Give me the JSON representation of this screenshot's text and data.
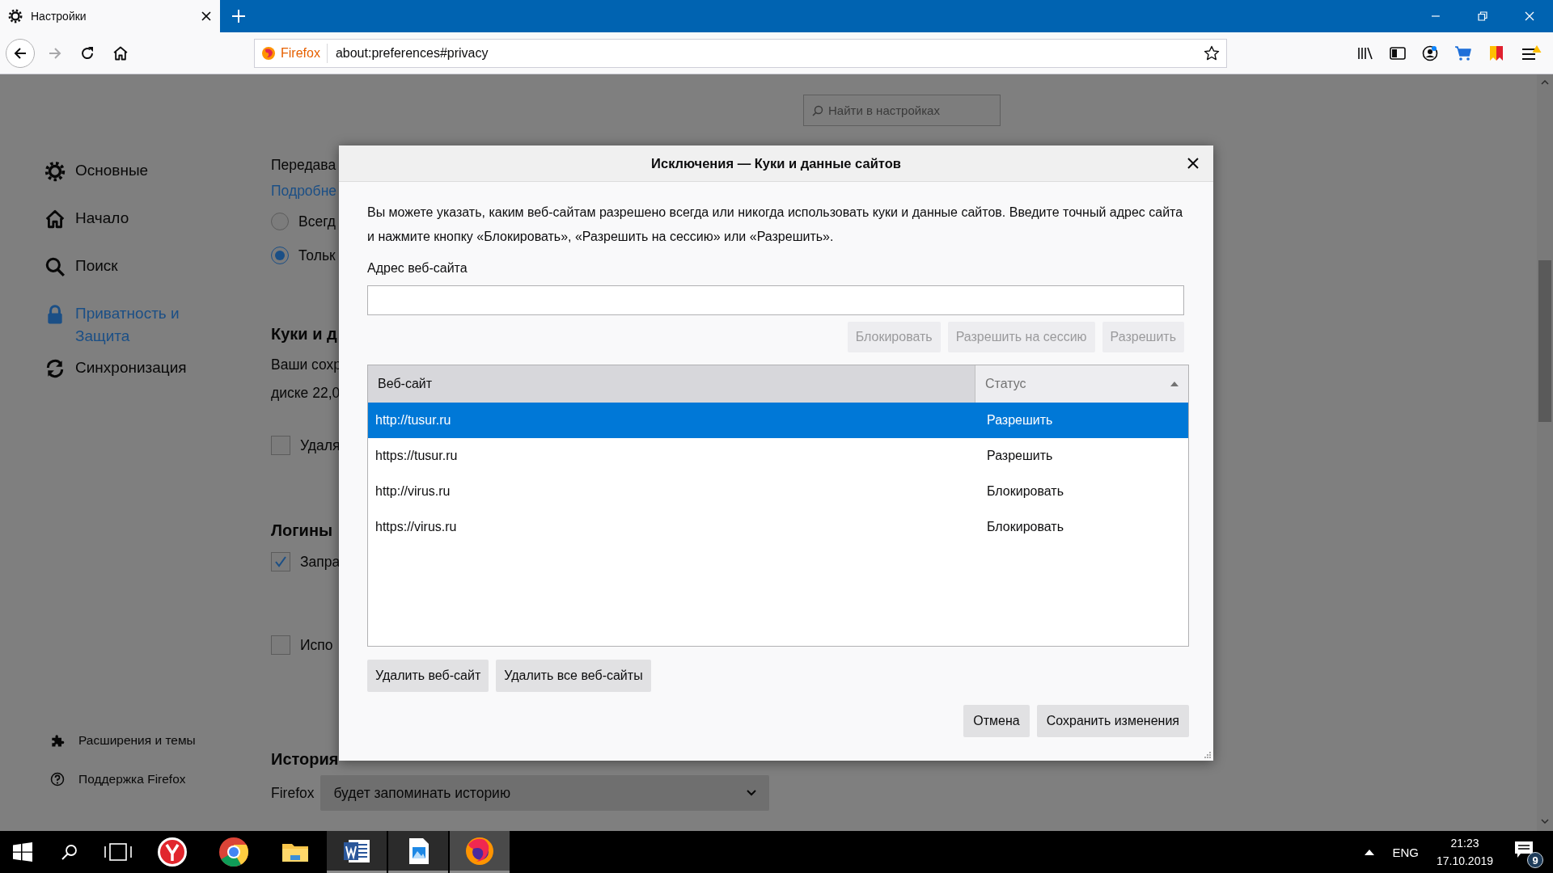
{
  "browser": {
    "tab": {
      "title": "Настройки"
    },
    "identity": "Firefox",
    "url": "about:preferences#privacy",
    "forward": {
      "disabled": true
    }
  },
  "search": {
    "placeholder": "Найти в настройках"
  },
  "sidebar": {
    "items": [
      {
        "label": "Основные",
        "selected": false
      },
      {
        "label": "Начало",
        "selected": false
      },
      {
        "label": "Поиск",
        "selected": false
      },
      {
        "label": "Приватность и Защита",
        "selected": true
      },
      {
        "label": "Синхронизация",
        "selected": false
      }
    ],
    "footer": [
      {
        "label": "Расширения и темы"
      },
      {
        "label": "Поддержка Firefox"
      }
    ]
  },
  "page": {
    "items": [
      {
        "kind": "text",
        "text": "Передава"
      },
      {
        "kind": "link",
        "text": "Подробне"
      },
      {
        "kind": "radio",
        "label": "Всегд",
        "selected": false
      },
      {
        "kind": "radio",
        "label": "Тольк",
        "selected": true
      },
      {
        "kind": "heading",
        "text": "Куки и д"
      },
      {
        "kind": "text",
        "text": "Ваши сохр"
      },
      {
        "kind": "text",
        "text": "диске 22,0"
      },
      {
        "kind": "checkbox",
        "label": "Удаля",
        "checked": false
      },
      {
        "kind": "heading",
        "text": "Логины"
      },
      {
        "kind": "checkbox",
        "label": "Запра",
        "checked": true
      },
      {
        "kind": "checkbox",
        "label": "Испо",
        "checked": false
      },
      {
        "kind": "heading",
        "text": "История"
      },
      {
        "kind": "select",
        "label": "Firefox",
        "value": "будет запоминать историю"
      }
    ]
  },
  "dialog": {
    "title": "Исключения — Куки и данные сайтов",
    "description": "Вы можете указать, каким веб-сайтам разрешено всегда или никогда использовать куки и данные сайтов. Введите точный адрес сайта и нажмите кнопку «Блокировать», «Разрешить на сессию» или «Разрешить».",
    "address_label": "Адрес веб-сайта",
    "actions": [
      {
        "label": "Блокировать",
        "disabled": true
      },
      {
        "label": "Разрешить на сессию",
        "disabled": true
      },
      {
        "label": "Разрешить",
        "disabled": true
      }
    ],
    "table": {
      "columns": [
        {
          "label": "Веб-сайт",
          "sorted": false
        },
        {
          "label": "Статус",
          "sorted": true
        }
      ],
      "rows": [
        {
          "site": "http://tusur.ru",
          "status": "Разрешить",
          "selected": true
        },
        {
          "site": "https://tusur.ru",
          "status": "Разрешить",
          "selected": false
        },
        {
          "site": "http://virus.ru",
          "status": "Блокировать",
          "selected": false
        },
        {
          "site": "https://virus.ru",
          "status": "Блокировать",
          "selected": false
        }
      ]
    },
    "remove_buttons": [
      "Удалить веб-сайт",
      "Удалить все веб-сайты"
    ],
    "footer_buttons": [
      "Отмена",
      "Сохранить изменения"
    ]
  },
  "taskbar": {
    "apps": [
      {
        "kind": "yandex",
        "running": false,
        "active": false
      },
      {
        "kind": "chrome",
        "running": false,
        "active": false
      },
      {
        "kind": "explorer",
        "running": false,
        "active": false
      },
      {
        "kind": "word",
        "running": true,
        "active": false
      },
      {
        "kind": "photos",
        "running": true,
        "active": false
      },
      {
        "kind": "firefox",
        "running": true,
        "active": true
      }
    ],
    "language": "ENG",
    "time": "21:23",
    "date": "17.10.2019",
    "notifications": "9"
  }
}
